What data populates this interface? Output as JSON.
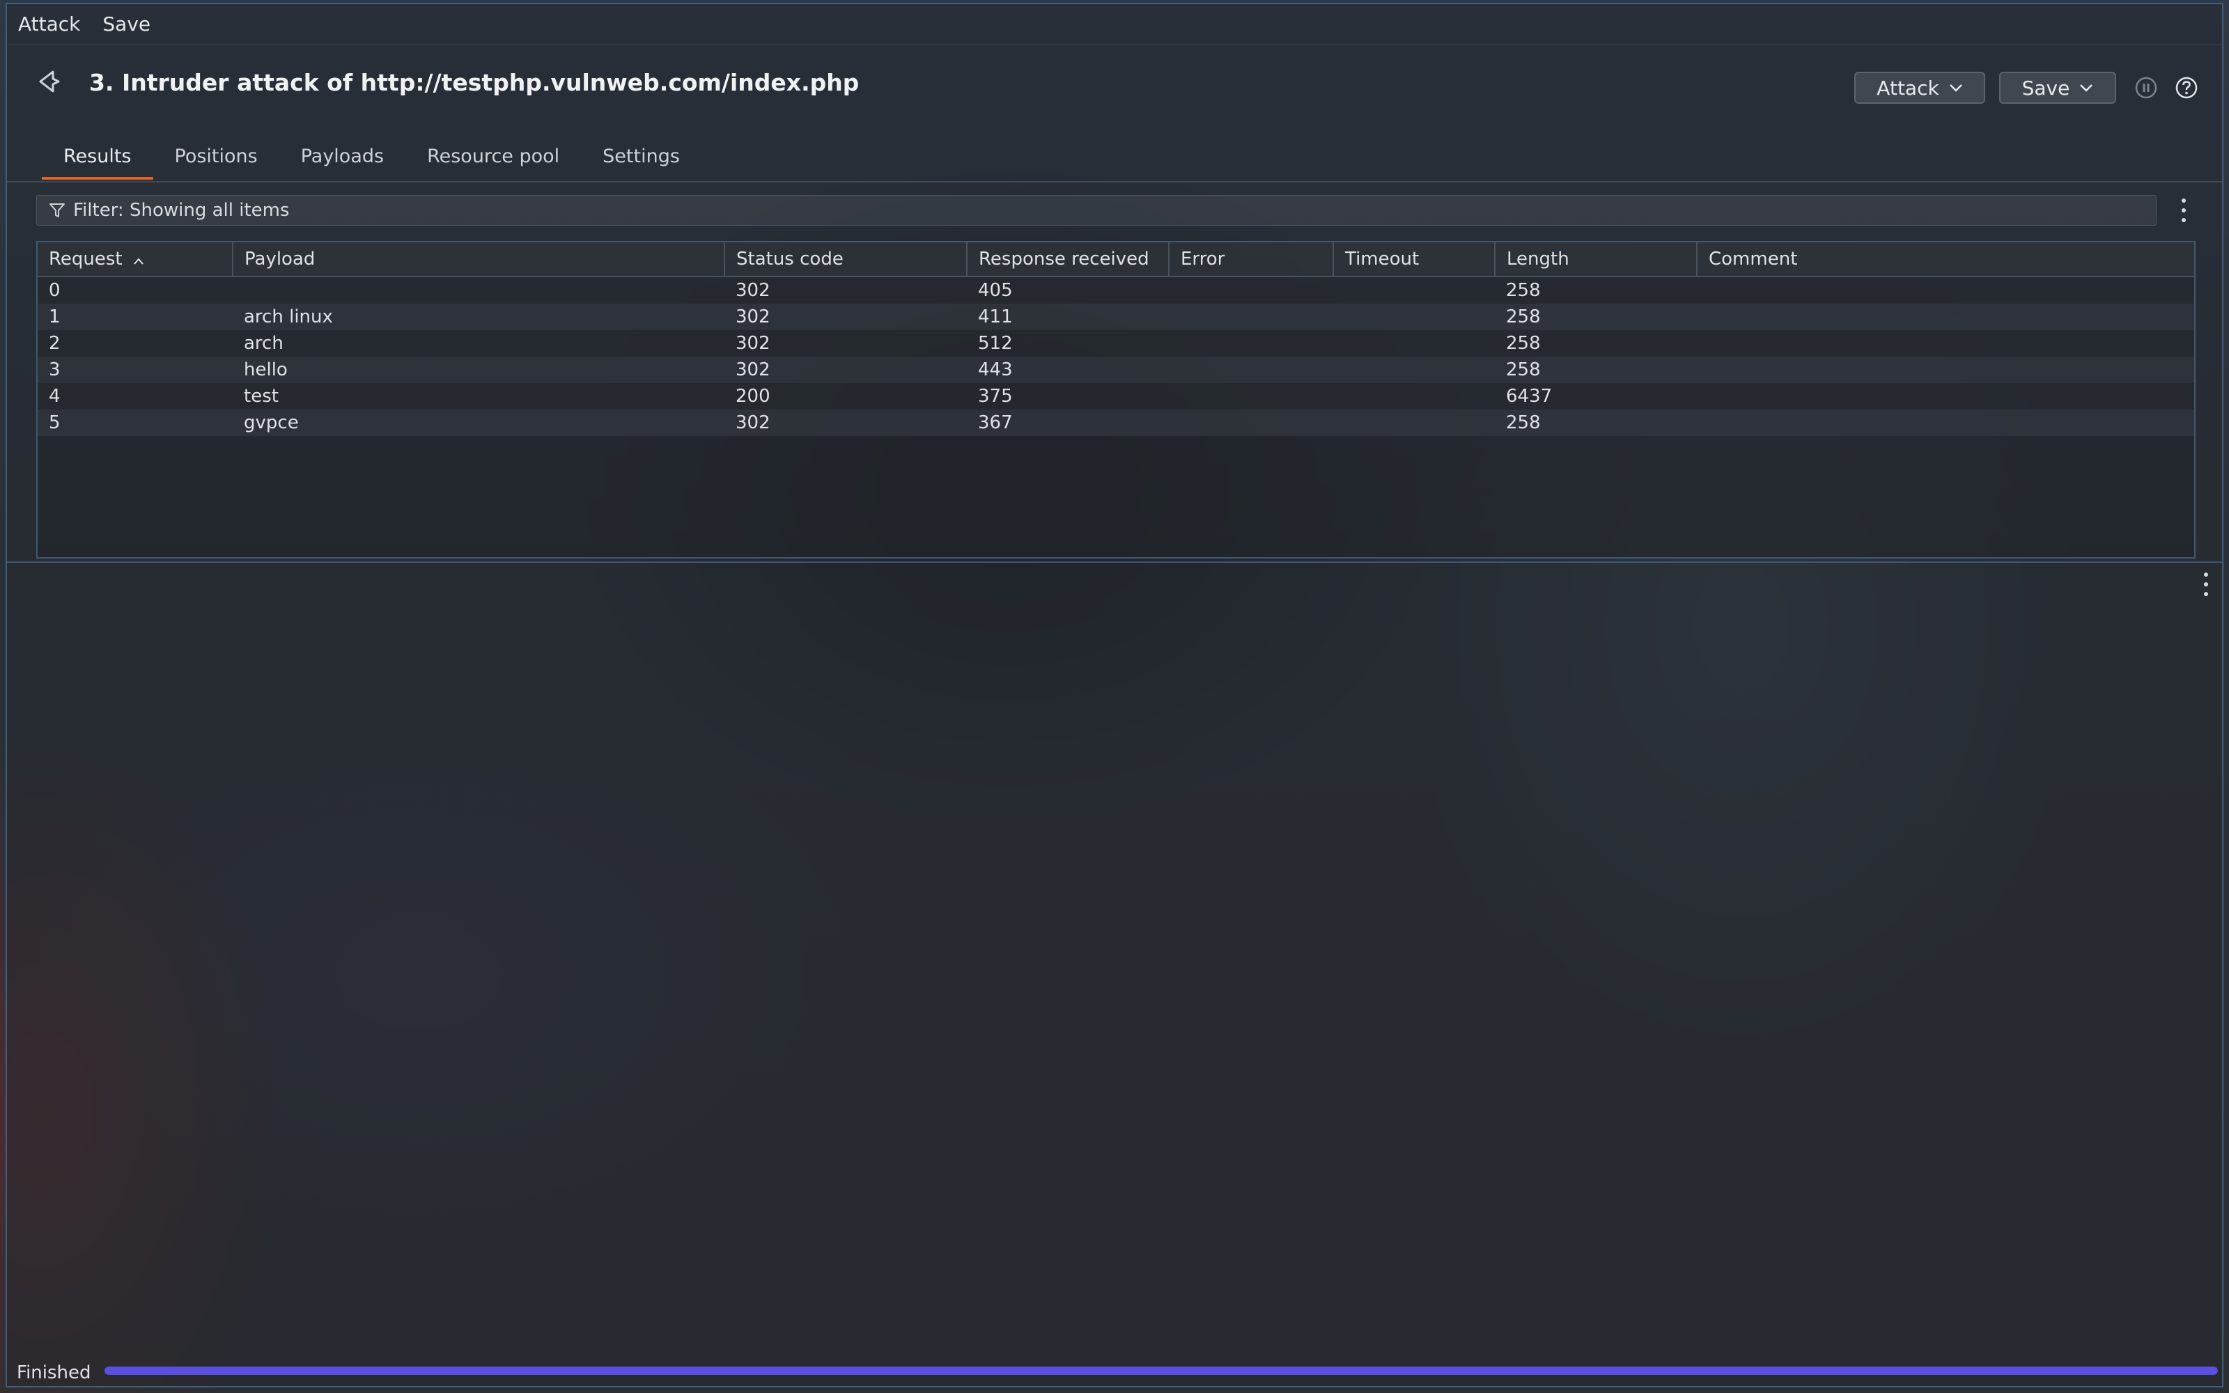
{
  "menubar": {
    "items": [
      "Attack",
      "Save"
    ]
  },
  "header": {
    "title": "3. Intruder attack of http://testphp.vulnweb.com/index.php",
    "attack_button": "Attack",
    "save_button": "Save",
    "icons": [
      "back-arrow-icon",
      "pause-icon",
      "help-icon"
    ]
  },
  "tabs": [
    {
      "label": "Results",
      "active": true
    },
    {
      "label": "Positions",
      "active": false
    },
    {
      "label": "Payloads",
      "active": false
    },
    {
      "label": "Resource pool",
      "active": false
    },
    {
      "label": "Settings",
      "active": false
    }
  ],
  "filter": {
    "label": "Filter: Showing all items",
    "icon": "filter-icon"
  },
  "results_table": {
    "columns": [
      "Request",
      "Payload",
      "Status code",
      "Response received",
      "Error",
      "Timeout",
      "Length",
      "Comment"
    ],
    "sorted_by": "Request",
    "rows": [
      {
        "request": "0",
        "payload": "",
        "status": "302",
        "response_received": "405",
        "error": "",
        "timeout": "",
        "length": "258",
        "comment": ""
      },
      {
        "request": "1",
        "payload": "arch linux",
        "status": "302",
        "response_received": "411",
        "error": "",
        "timeout": "",
        "length": "258",
        "comment": ""
      },
      {
        "request": "2",
        "payload": "arch",
        "status": "302",
        "response_received": "512",
        "error": "",
        "timeout": "",
        "length": "258",
        "comment": ""
      },
      {
        "request": "3",
        "payload": "hello",
        "status": "302",
        "response_received": "443",
        "error": "",
        "timeout": "",
        "length": "258",
        "comment": ""
      },
      {
        "request": "4",
        "payload": "test",
        "status": "200",
        "response_received": "375",
        "error": "",
        "timeout": "",
        "length": "6437",
        "comment": ""
      },
      {
        "request": "5",
        "payload": "gvpce",
        "status": "302",
        "response_received": "367",
        "error": "",
        "timeout": "",
        "length": "258",
        "comment": ""
      }
    ]
  },
  "status_bar": {
    "label": "Finished",
    "progress": 1.0
  },
  "colors": {
    "accent_tab": "#e0632c",
    "progress": "#5b4fe0",
    "border": "#3e5a72"
  }
}
